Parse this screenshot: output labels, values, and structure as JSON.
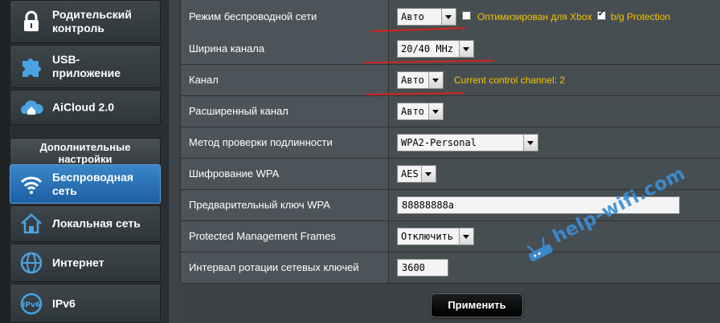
{
  "sidebar": {
    "items_top": [
      {
        "label": "Родительский\nконтроль",
        "icon": "lock-icon"
      },
      {
        "label": "USB-\nприложение",
        "icon": "puzzle-icon"
      },
      {
        "label": "AiCloud 2.0",
        "icon": "cloud-home-icon"
      }
    ],
    "section_header": "Дополнительные\nнастройки",
    "items_advanced": [
      {
        "label": "Беспроводная\nсеть",
        "icon": "wifi-icon",
        "active": true
      },
      {
        "label": "Локальная сеть",
        "icon": "home-icon"
      },
      {
        "label": "Интернет",
        "icon": "globe-icon"
      },
      {
        "label": "IPv6",
        "icon": "ipv6-icon"
      }
    ]
  },
  "settings": {
    "rows": [
      {
        "label": "Режим беспроводной сети",
        "value": "Авто"
      },
      {
        "label": "Ширина канала",
        "value": "20/40 MHz"
      },
      {
        "label": "Канал",
        "value": "Авто"
      },
      {
        "label": "Расширенный канал",
        "value": "Авто"
      },
      {
        "label": "Метод проверки подлинности",
        "value": "WPA2-Personal"
      },
      {
        "label": "Шифрование WPA",
        "value": "AES"
      },
      {
        "label": "Предварительный ключ WPA",
        "value": "88888888a"
      },
      {
        "label": "Protected Management Frames",
        "value": "Отключить"
      },
      {
        "label": "Интервал ротации сетевых ключей",
        "value": "3600"
      }
    ],
    "xbox_label": "Оптимизирован для Xbox",
    "xbox_checked": false,
    "bg_label": "b/g Protection",
    "bg_checked": true,
    "channel_note": "Current control channel: 2"
  },
  "apply_label": "Применить",
  "watermark": "help-wifi.com",
  "colors": {
    "accent_yellow": "#f5c400",
    "active_blue": "#2a73b9",
    "annotation_red": "#d2231e",
    "watermark_blue": "#3a8fd6"
  }
}
